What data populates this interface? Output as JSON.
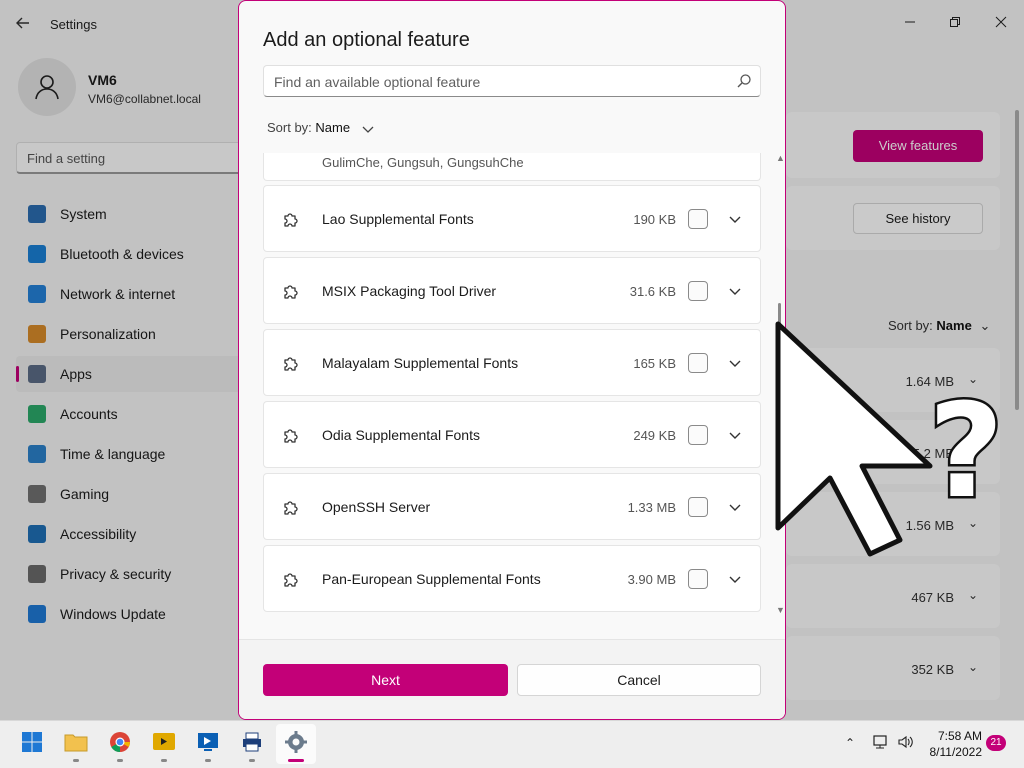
{
  "settings": {
    "title": "Settings",
    "profile": {
      "name": "VM6",
      "email": "VM6@collabnet.local"
    },
    "search_placeholder": "Find a setting",
    "nav": [
      {
        "label": "System",
        "icon": "system-icon",
        "color": "#2b6cb0"
      },
      {
        "label": "Bluetooth & devices",
        "icon": "bluetooth-icon",
        "color": "#1a7fd4"
      },
      {
        "label": "Network & internet",
        "icon": "network-icon",
        "color": "#2480d6"
      },
      {
        "label": "Personalization",
        "icon": "brush-icon",
        "color": "#d68a2a"
      },
      {
        "label": "Apps",
        "icon": "apps-icon",
        "color": "#5a6b85"
      },
      {
        "label": "Accounts",
        "icon": "accounts-icon",
        "color": "#2ba86a"
      },
      {
        "label": "Time & language",
        "icon": "time-language-icon",
        "color": "#2b80c8"
      },
      {
        "label": "Gaming",
        "icon": "gaming-icon",
        "color": "#707070"
      },
      {
        "label": "Accessibility",
        "icon": "accessibility-icon",
        "color": "#1e6fb5"
      },
      {
        "label": "Privacy & security",
        "icon": "shield-icon",
        "color": "#6a6a6a"
      },
      {
        "label": "Windows Update",
        "icon": "windows-update-icon",
        "color": "#1e78d4"
      }
    ],
    "active_nav": "Apps",
    "view_features_label": "View features",
    "see_history_label": "See history",
    "sort_by_label": "Sort by:",
    "sort_by_value": "Name",
    "bg_sizes": [
      "1.64 MB",
      "15.2 MB",
      "1.56 MB",
      "467 KB",
      "352 KB"
    ]
  },
  "dialog": {
    "title": "Add an optional feature",
    "search_placeholder": "Find an available optional feature",
    "sort_by_label": "Sort by:",
    "sort_by_value": "Name",
    "partial_item_text": "GulimChe, Gungsuh, GungsuhChe",
    "features": [
      {
        "name": "Lao Supplemental Fonts",
        "size": "190 KB",
        "checked": false
      },
      {
        "name": "MSIX Packaging Tool Driver",
        "size": "31.6 KB",
        "checked": false
      },
      {
        "name": "Malayalam Supplemental Fonts",
        "size": "165 KB",
        "checked": false
      },
      {
        "name": "Odia Supplemental Fonts",
        "size": "249 KB",
        "checked": false
      },
      {
        "name": "OpenSSH Server",
        "size": "1.33 MB",
        "checked": false
      },
      {
        "name": "Pan-European Supplemental Fonts",
        "size": "3.90 MB",
        "checked": false
      }
    ],
    "next_label": "Next",
    "cancel_label": "Cancel"
  },
  "taskbar": {
    "apps": [
      {
        "name": "start-button",
        "icon": "windows-logo-icon",
        "active": false,
        "running": false
      },
      {
        "name": "file-explorer",
        "icon": "folder-icon",
        "active": false,
        "running": true
      },
      {
        "name": "chrome",
        "icon": "chrome-icon",
        "active": false,
        "running": true
      },
      {
        "name": "media-app",
        "icon": "media-icon",
        "active": false,
        "running": true
      },
      {
        "name": "remote-desktop",
        "icon": "remote-desktop-icon",
        "active": false,
        "running": true
      },
      {
        "name": "print-app",
        "icon": "printer-icon",
        "active": false,
        "running": true
      },
      {
        "name": "settings",
        "icon": "gear-icon",
        "active": true,
        "running": true
      }
    ],
    "time": "7:58 AM",
    "date": "8/11/2022",
    "notification_count": "21"
  },
  "overlay": {
    "symbol": "?"
  },
  "colors": {
    "accent": "#c30078"
  }
}
